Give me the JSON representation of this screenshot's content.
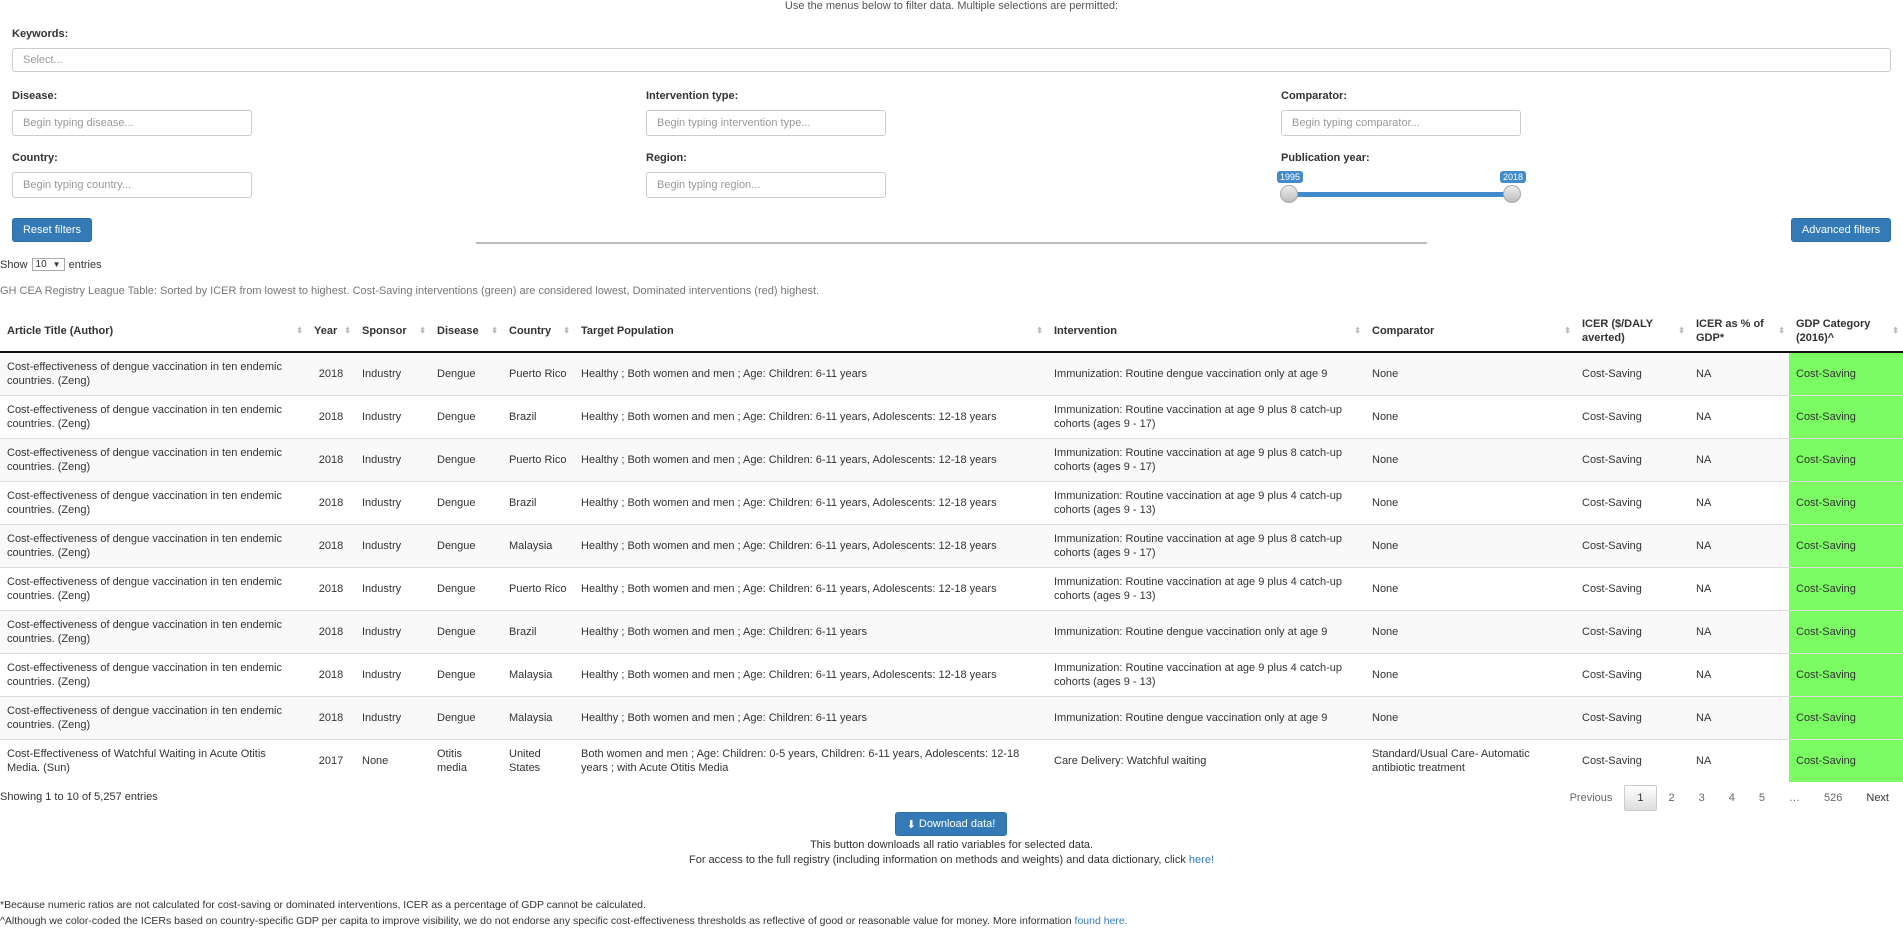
{
  "intro": "Use the menus below to filter data. Multiple selections are permitted:",
  "filters": {
    "keywords_label": "Keywords:",
    "keywords_placeholder": "Select...",
    "disease_label": "Disease:",
    "disease_placeholder": "Begin typing disease...",
    "intervention_label": "Intervention type:",
    "intervention_placeholder": "Begin typing intervention type...",
    "comparator_label": "Comparator:",
    "comparator_placeholder": "Begin typing comparator...",
    "country_label": "Country:",
    "country_placeholder": "Begin typing country...",
    "region_label": "Region:",
    "region_placeholder": "Begin typing region...",
    "year_label": "Publication year:",
    "year_min": "1995",
    "year_max": "2018",
    "reset_label": "Reset filters",
    "advanced_label": "Advanced filters"
  },
  "length": {
    "show": "Show",
    "value": "10",
    "entries": "entries"
  },
  "caption": "GH CEA Registry League Table: Sorted by ICER from lowest to highest. Cost-Saving interventions (green) are considered lowest, Dominated interventions (red) highest.",
  "table": {
    "headers": [
      "Article Title (Author)",
      "Year",
      "Sponsor",
      "Disease",
      "Country",
      "Target Population",
      "Intervention",
      "Comparator",
      "ICER ($/DALY averted)",
      "ICER as % of GDP*",
      "GDP Category (2016)^"
    ],
    "rows": [
      [
        "Cost-effectiveness of dengue vaccination in ten endemic countries. (Zeng)",
        "2018",
        "Industry",
        "Dengue",
        "Puerto Rico",
        "Healthy ; Both women and men ; Age: Children: 6-11 years",
        "Immunization: Routine dengue vaccination only at age 9",
        "None",
        "Cost-Saving",
        "NA",
        "Cost-Saving"
      ],
      [
        "Cost-effectiveness of dengue vaccination in ten endemic countries. (Zeng)",
        "2018",
        "Industry",
        "Dengue",
        "Brazil",
        "Healthy ; Both women and men ; Age: Children: 6-11 years, Adolescents: 12-18 years",
        "Immunization: Routine vaccination at age 9 plus 8 catch-up cohorts (ages 9 - 17)",
        "None",
        "Cost-Saving",
        "NA",
        "Cost-Saving"
      ],
      [
        "Cost-effectiveness of dengue vaccination in ten endemic countries. (Zeng)",
        "2018",
        "Industry",
        "Dengue",
        "Puerto Rico",
        "Healthy ; Both women and men ; Age: Children: 6-11 years, Adolescents: 12-18 years",
        "Immunization: Routine vaccination at age 9 plus 8 catch-up cohorts (ages 9 - 17)",
        "None",
        "Cost-Saving",
        "NA",
        "Cost-Saving"
      ],
      [
        "Cost-effectiveness of dengue vaccination in ten endemic countries. (Zeng)",
        "2018",
        "Industry",
        "Dengue",
        "Brazil",
        "Healthy ; Both women and men ; Age: Children: 6-11 years, Adolescents: 12-18 years",
        "Immunization: Routine vaccination at age 9 plus 4 catch-up cohorts (ages 9 - 13)",
        "None",
        "Cost-Saving",
        "NA",
        "Cost-Saving"
      ],
      [
        "Cost-effectiveness of dengue vaccination in ten endemic countries. (Zeng)",
        "2018",
        "Industry",
        "Dengue",
        "Malaysia",
        "Healthy ; Both women and men ; Age: Children: 6-11 years, Adolescents: 12-18 years",
        "Immunization: Routine vaccination at age 9 plus 8 catch-up cohorts (ages 9 - 17)",
        "None",
        "Cost-Saving",
        "NA",
        "Cost-Saving"
      ],
      [
        "Cost-effectiveness of dengue vaccination in ten endemic countries. (Zeng)",
        "2018",
        "Industry",
        "Dengue",
        "Puerto Rico",
        "Healthy ; Both women and men ; Age: Children: 6-11 years, Adolescents: 12-18 years",
        "Immunization: Routine vaccination at age 9 plus 4 catch-up cohorts (ages 9 - 13)",
        "None",
        "Cost-Saving",
        "NA",
        "Cost-Saving"
      ],
      [
        "Cost-effectiveness of dengue vaccination in ten endemic countries. (Zeng)",
        "2018",
        "Industry",
        "Dengue",
        "Brazil",
        "Healthy ; Both women and men ; Age: Children: 6-11 years",
        "Immunization: Routine dengue vaccination only at age 9",
        "None",
        "Cost-Saving",
        "NA",
        "Cost-Saving"
      ],
      [
        "Cost-effectiveness of dengue vaccination in ten endemic countries. (Zeng)",
        "2018",
        "Industry",
        "Dengue",
        "Malaysia",
        "Healthy ; Both women and men ; Age: Children: 6-11 years, Adolescents: 12-18 years",
        "Immunization: Routine vaccination at age 9 plus 4 catch-up cohorts (ages 9 - 13)",
        "None",
        "Cost-Saving",
        "NA",
        "Cost-Saving"
      ],
      [
        "Cost-effectiveness of dengue vaccination in ten endemic countries. (Zeng)",
        "2018",
        "Industry",
        "Dengue",
        "Malaysia",
        "Healthy ; Both women and men ; Age: Children: 6-11 years",
        "Immunization: Routine dengue vaccination only at age 9",
        "None",
        "Cost-Saving",
        "NA",
        "Cost-Saving"
      ],
      [
        "Cost-Effectiveness of Watchful Waiting in Acute Otitis Media. (Sun)",
        "2017",
        "None",
        "Otitis media",
        "United States",
        "Both women and men ; Age: Children: 0-5 years, Children: 6-11 years, Adolescents: 12-18 years ; with Acute Otitis Media",
        "Care Delivery: Watchful waiting",
        "Standard/Usual Care- Automatic antibiotic treatment",
        "Cost-Saving",
        "NA",
        "Cost-Saving"
      ]
    ]
  },
  "info": "Showing 1 to 10 of 5,257 entries",
  "pagination": [
    "Previous",
    "1",
    "2",
    "3",
    "4",
    "5",
    "…",
    "526",
    "Next"
  ],
  "download": {
    "button": "Download data!",
    "note1": "This button downloads all ratio variables for selected data.",
    "note2_prefix": "For access to the full registry (including information on methods and weights) and data dictionary, click",
    "note2_link": "here!"
  },
  "footnotes": {
    "star": "*Because numeric ratios are not calculated for cost-saving or dominated interventions, ICER as a percentage of GDP cannot be calculated.",
    "caret_prefix": "^Although we color-coded the ICERs based on country-specific GDP per capita to improve visibility, we do not endorse any specific cost-effectiveness thresholds as reflective of good or reasonable value for money. More information",
    "caret_link": "found here."
  },
  "colors": {
    "primary": "#337ab7",
    "cost_saving": "#7cfc63"
  }
}
